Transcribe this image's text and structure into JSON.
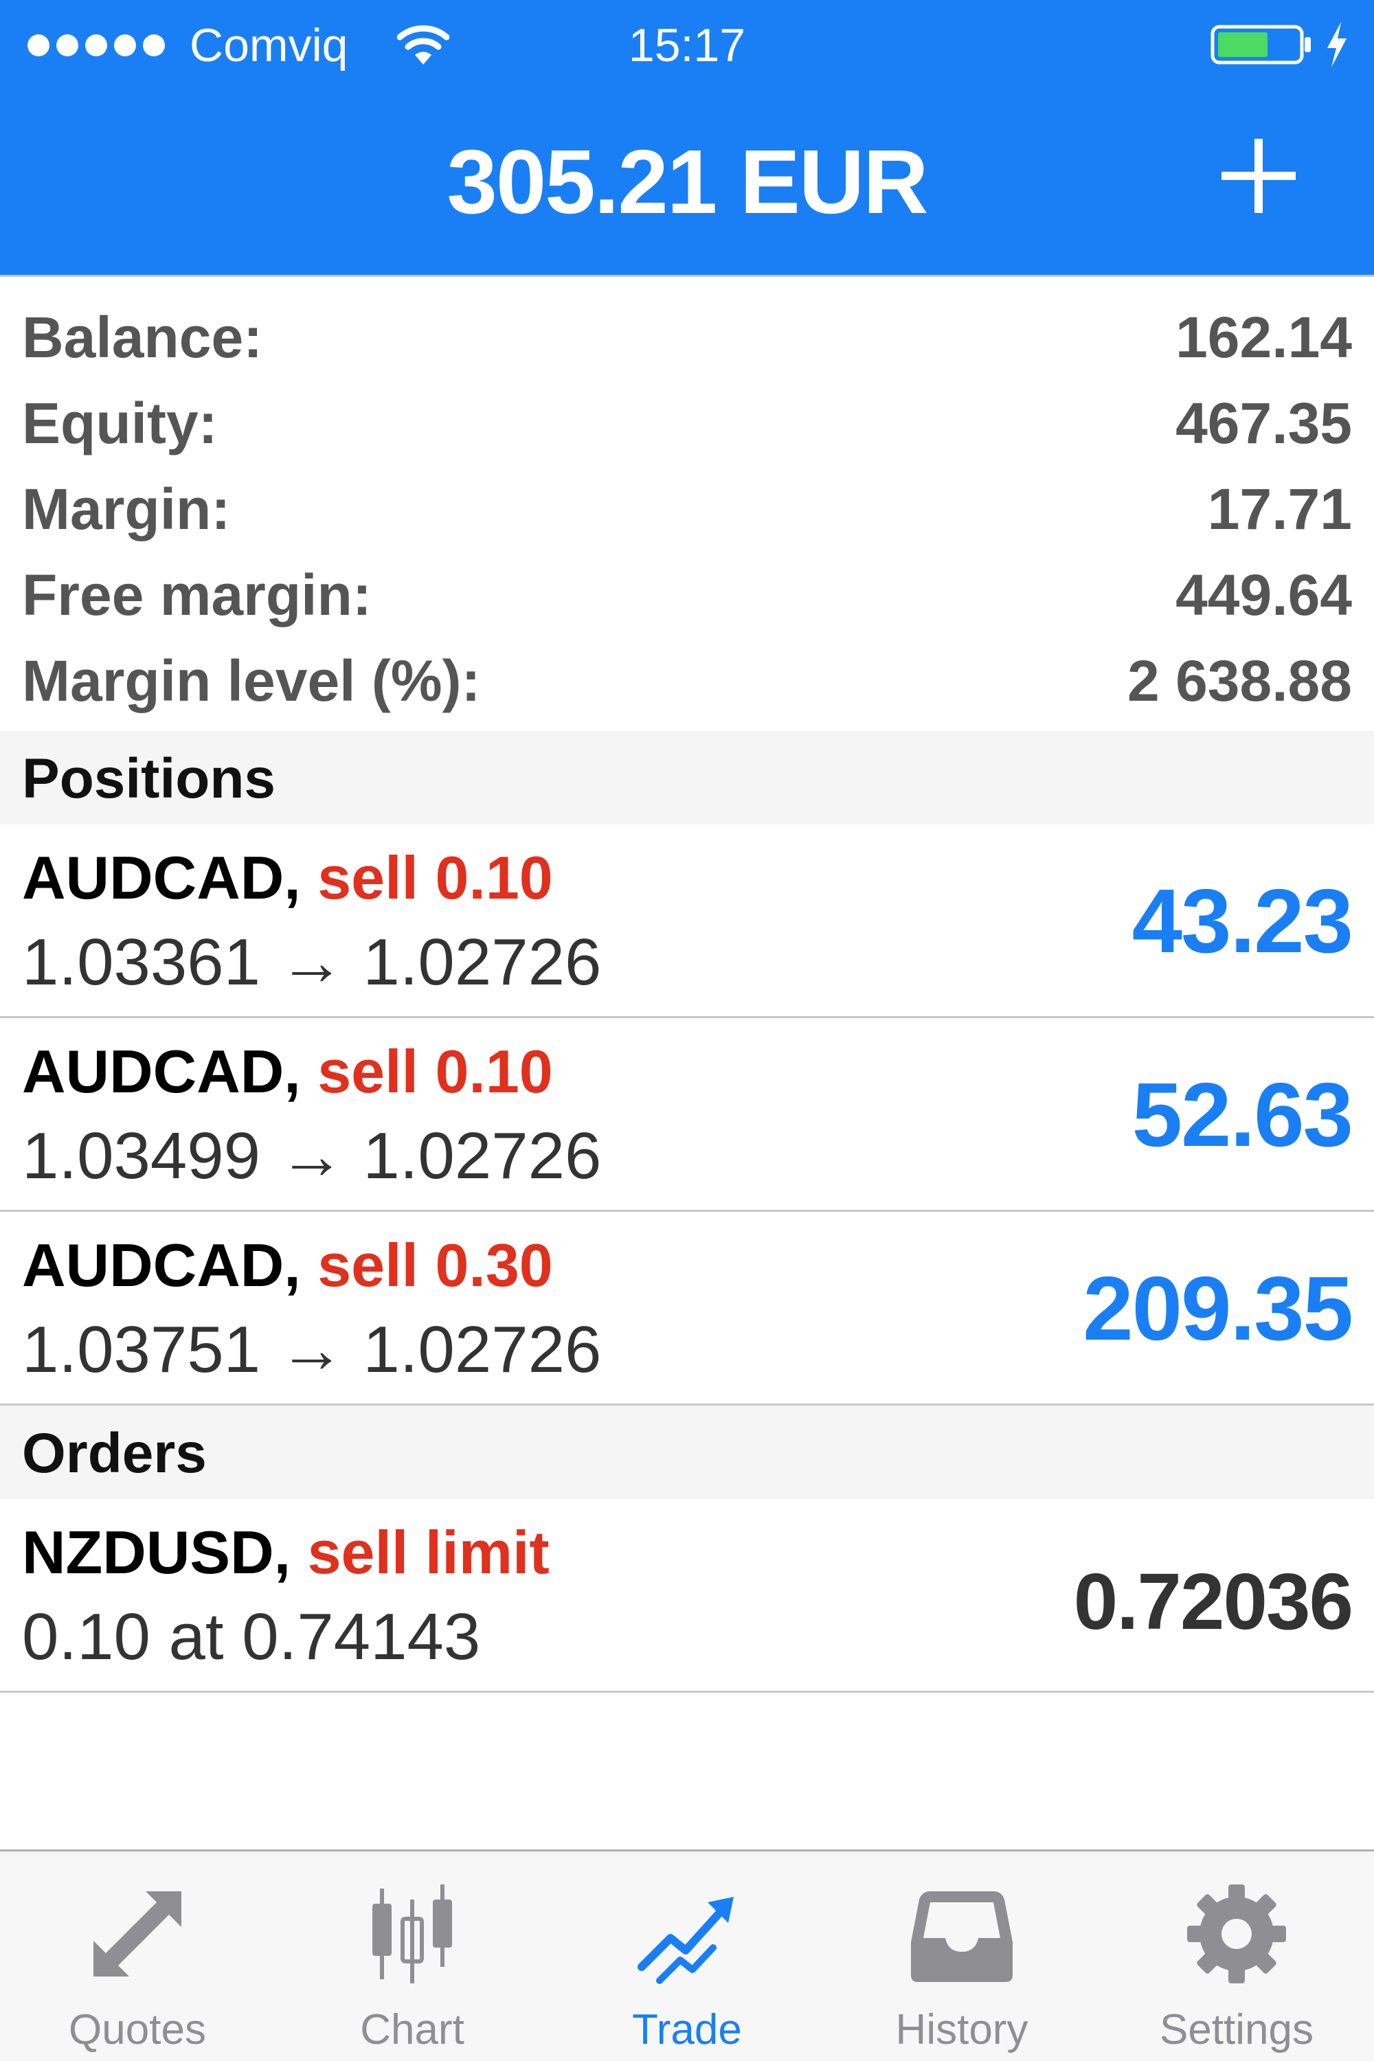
{
  "status_bar": {
    "carrier": "Comviq",
    "time": "15:17",
    "signal_bars": 5,
    "battery_color": "#4cd964"
  },
  "header": {
    "title": "305.21 EUR",
    "add_icon": "plus-icon",
    "background_color": "#1a7ff4"
  },
  "summary": [
    {
      "label": "Balance:",
      "value": "162.14"
    },
    {
      "label": "Equity:",
      "value": "467.35"
    },
    {
      "label": "Margin:",
      "value": "17.71"
    },
    {
      "label": "Free margin:",
      "value": "449.64"
    },
    {
      "label": "Margin level (%):",
      "value": "2 638.88"
    }
  ],
  "positions": {
    "title": "Positions",
    "items": [
      {
        "symbol": "AUDCAD,",
        "side": "sell 0.10",
        "open_price": "1.03361",
        "arrow": "→",
        "current_price": "1.02726",
        "profit": "43.23"
      },
      {
        "symbol": "AUDCAD,",
        "side": "sell 0.10",
        "open_price": "1.03499",
        "arrow": "→",
        "current_price": "1.02726",
        "profit": "52.63"
      },
      {
        "symbol": "AUDCAD,",
        "side": "sell 0.30",
        "open_price": "1.03751",
        "arrow": "→",
        "current_price": "1.02726",
        "profit": "209.35"
      }
    ]
  },
  "orders": {
    "title": "Orders",
    "items": [
      {
        "symbol": "NZDUSD,",
        "side": "sell limit",
        "detail": "0.10 at 0.74143",
        "price": "0.72036"
      }
    ]
  },
  "colors": {
    "accent": "#1a7ff4",
    "sell": "#e0301e",
    "inactive_tab": "#8e8e93"
  },
  "tabbar": {
    "tabs": [
      {
        "label": "Quotes",
        "icon": "quotes-icon",
        "active": false
      },
      {
        "label": "Chart",
        "icon": "candlestick-icon",
        "active": false
      },
      {
        "label": "Trade",
        "icon": "trade-icon",
        "active": true
      },
      {
        "label": "History",
        "icon": "inbox-icon",
        "active": false
      },
      {
        "label": "Settings",
        "icon": "gear-icon",
        "active": false
      }
    ]
  }
}
